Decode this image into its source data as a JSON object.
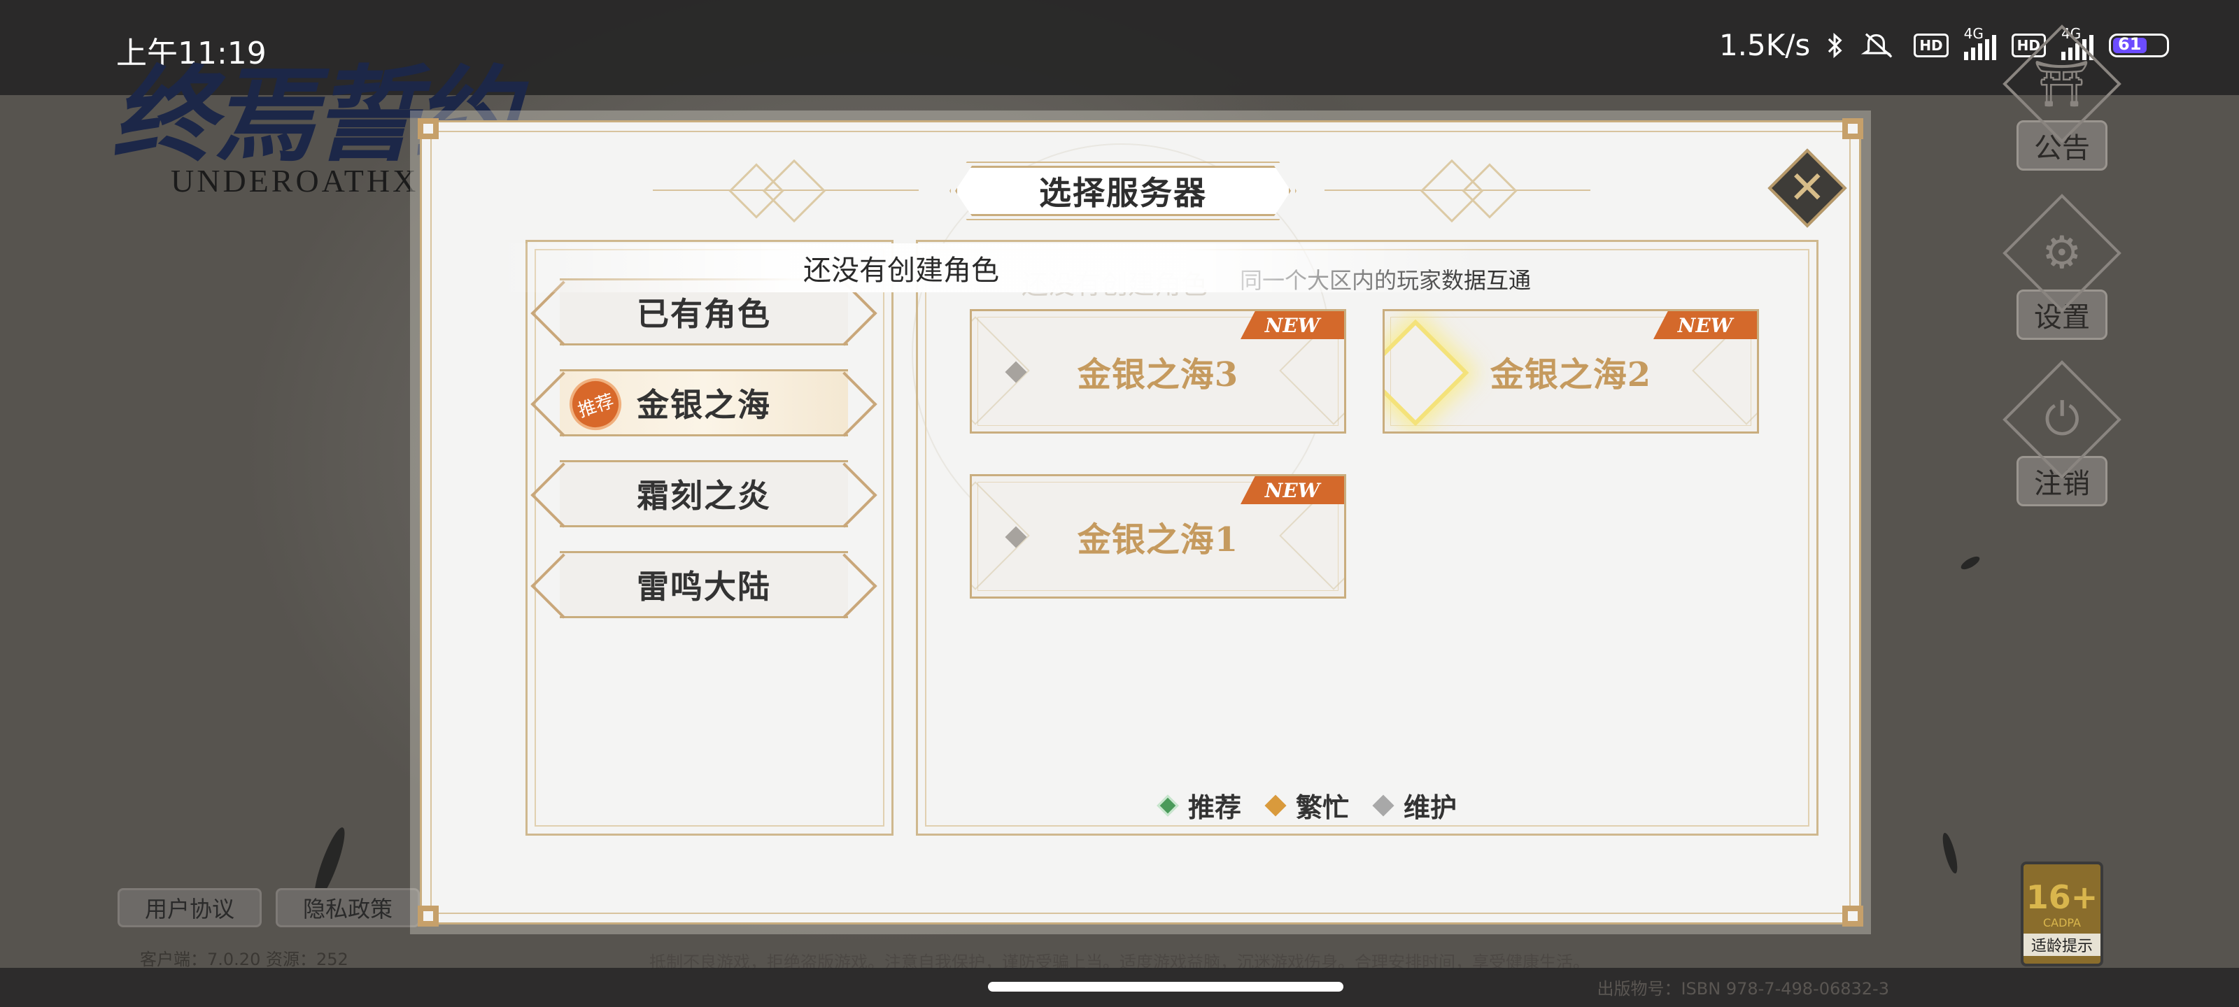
{
  "status_bar": {
    "time": "上午11:19",
    "net_speed": "1.5K/s",
    "hd1": "HD",
    "hd2": "HD",
    "lte1": "4G",
    "lte2": "4G",
    "battery": "61"
  },
  "logo": {
    "title": "终焉誓约",
    "subtitle": "UNDEROATHX"
  },
  "side_menu": {
    "notice": "公告",
    "settings": "设置",
    "logout": "注销"
  },
  "footer": {
    "user_agreement": "用户协议",
    "privacy_policy": "隐私政策",
    "version": "客户端：7.0.20  资源：252",
    "health_notice": "抵制不良游戏，拒绝盗版游戏。注意自我保护，谨防受骗上当。适度游戏益脑，沉迷游戏伤身。合理安排时间，享受健康生活。",
    "publish_info": "出版物号：ISBN 978-7-498-06832-3"
  },
  "age_rating": {
    "value": "16+",
    "org": "CADPA",
    "tip": "适龄提示"
  },
  "dialog": {
    "title": "选择服务器",
    "close_icon": "✕",
    "regions": [
      {
        "label": "已有角色",
        "active": false
      },
      {
        "label": "金银之海",
        "active": true,
        "badge": "推荐"
      },
      {
        "label": "霜刻之炎",
        "active": false
      },
      {
        "label": "雷鸣大陆",
        "active": false
      }
    ],
    "ghost_text": "还没有创建角色",
    "note": "同一个大区内的玩家数据互通",
    "servers": [
      {
        "name": "金银之海3",
        "tag": "NEW"
      },
      {
        "name": "金银之海2",
        "tag": "NEW"
      },
      {
        "name": "金银之海1",
        "tag": "NEW"
      }
    ],
    "legend": [
      {
        "label": "推荐",
        "color": "#4a9a5a"
      },
      {
        "label": "繁忙",
        "color": "#d99a3c"
      },
      {
        "label": "维护",
        "color": "#a8a8a8"
      }
    ]
  },
  "toast": "还没有创建角色"
}
